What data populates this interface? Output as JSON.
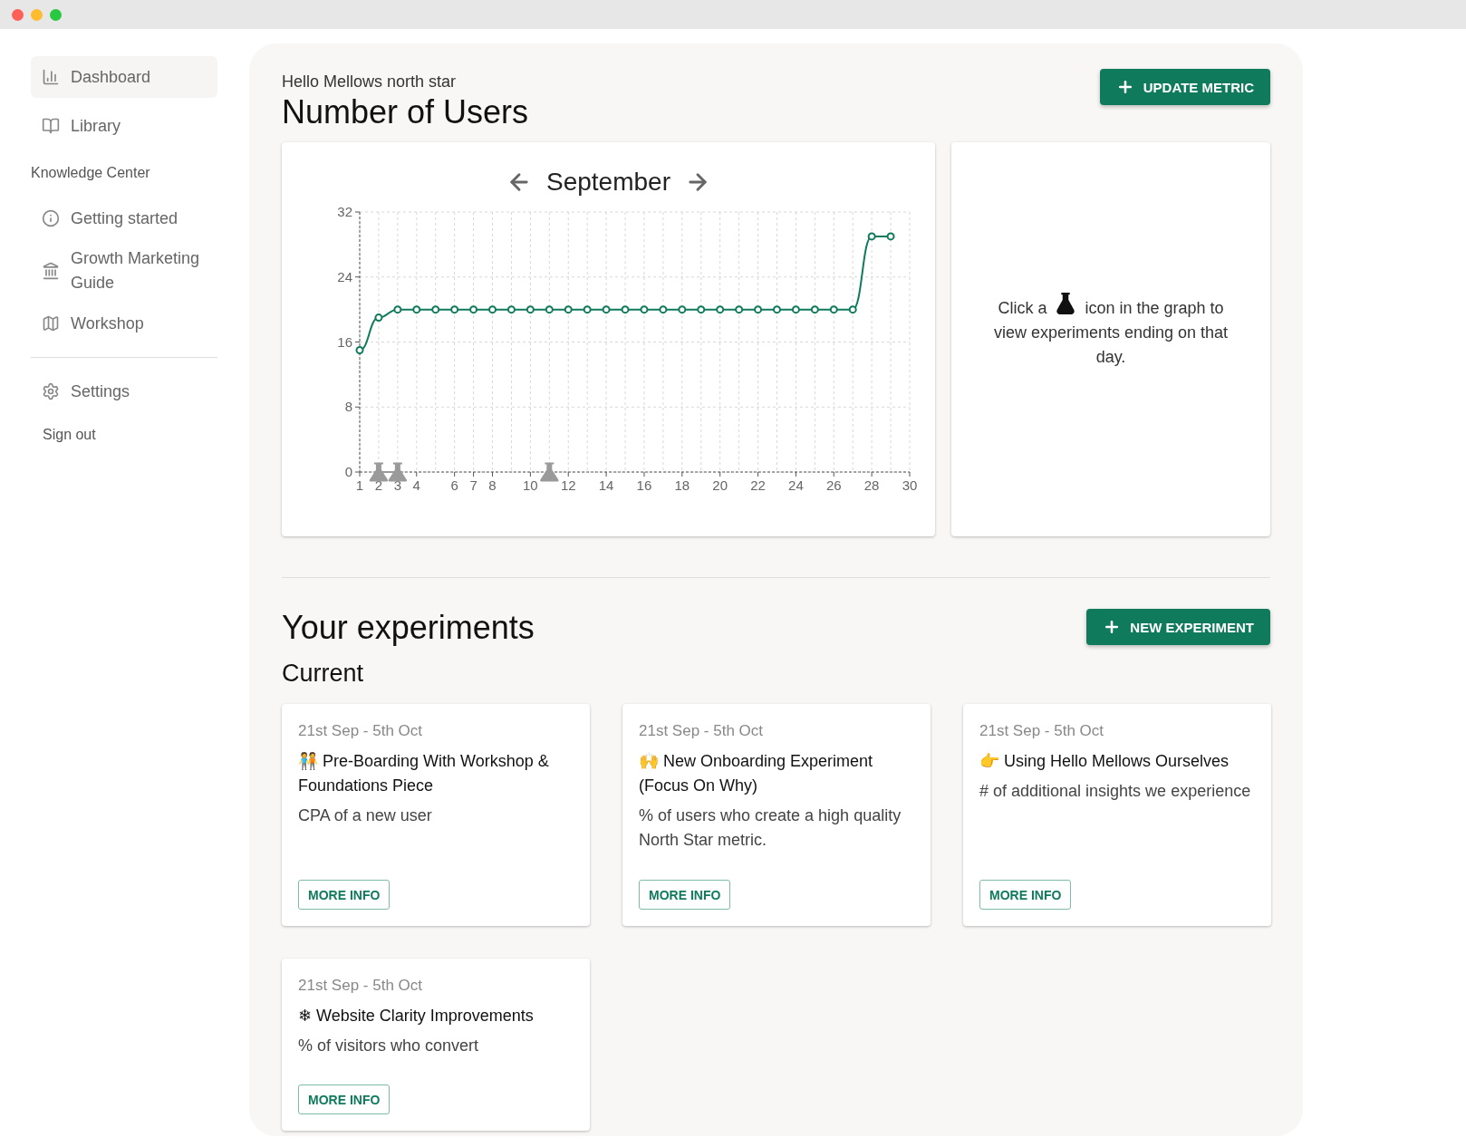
{
  "sidebar": {
    "items": [
      {
        "label": "Dashboard",
        "selected": true
      },
      {
        "label": "Library",
        "selected": false
      }
    ],
    "section_title": "Knowledge Center",
    "knowledge_items": [
      {
        "label": "Getting started"
      },
      {
        "label": "Growth Marketing Guide"
      },
      {
        "label": "Workshop"
      }
    ],
    "settings": "Settings",
    "sign_out": "Sign out"
  },
  "header": {
    "subtitle": "Hello Mellows north star",
    "title": "Number of Users",
    "button": "UPDATE METRIC"
  },
  "chart_card": {
    "month": "September",
    "chart_data": {
      "type": "line",
      "x": [
        1,
        2,
        3,
        4,
        5,
        6,
        7,
        8,
        9,
        10,
        11,
        12,
        13,
        14,
        15,
        16,
        17,
        18,
        19,
        20,
        21,
        22,
        23,
        24,
        25,
        26,
        27,
        28,
        29
      ],
      "series": [
        {
          "color": "#0f7b5c",
          "marker": "circle",
          "values": [
            15,
            19,
            20,
            20,
            20,
            20,
            20,
            20,
            20,
            20,
            20,
            20,
            20,
            20,
            20,
            20,
            20,
            20,
            20,
            20,
            20,
            20,
            20,
            20,
            20,
            20,
            20,
            29,
            29
          ]
        },
        {
          "color": "#9a9a9a",
          "marker": "triangle",
          "values": [
            null,
            0,
            0,
            null,
            null,
            null,
            null,
            null,
            null,
            null,
            0,
            null,
            null,
            null,
            null,
            null,
            null,
            null,
            null,
            null,
            null,
            null,
            null,
            null,
            null,
            null,
            null,
            null,
            null
          ]
        }
      ],
      "xlim": [
        1,
        30
      ],
      "ylim": [
        0,
        32
      ],
      "xticks": [
        1,
        2,
        3,
        4,
        6,
        7,
        8,
        10,
        12,
        14,
        16,
        18,
        20,
        22,
        24,
        26,
        28,
        30
      ],
      "yticks": [
        0,
        8,
        16,
        24,
        32
      ],
      "grid": true
    }
  },
  "hint": {
    "before": "Click a",
    "after": "icon in the graph to",
    "rest": "view experiments ending on that day."
  },
  "experiments": {
    "title": "Your experiments",
    "button": "NEW EXPERIMENT",
    "section": "Current",
    "cards": [
      {
        "dates": "21st Sep - 5th Oct",
        "title": "🧑‍🤝‍🧑 Pre-Boarding With Workshop & Foundations Piece",
        "metric": "CPA of a new user",
        "button": "MORE INFO"
      },
      {
        "dates": "21st Sep - 5th Oct",
        "title": "🙌 New Onboarding Experiment (Focus On Why)",
        "metric": "% of users who create a high quality North Star metric.",
        "button": "MORE INFO"
      },
      {
        "dates": "21st Sep - 5th Oct",
        "title": "👉 Using Hello Mellows Ourselves",
        "metric": "# of additional insights we experience",
        "button": "MORE INFO"
      },
      {
        "dates": "21st Sep - 5th Oct",
        "title": "❄ Website Clarity Improvements",
        "metric": "% of visitors who convert",
        "button": "MORE INFO"
      }
    ]
  }
}
